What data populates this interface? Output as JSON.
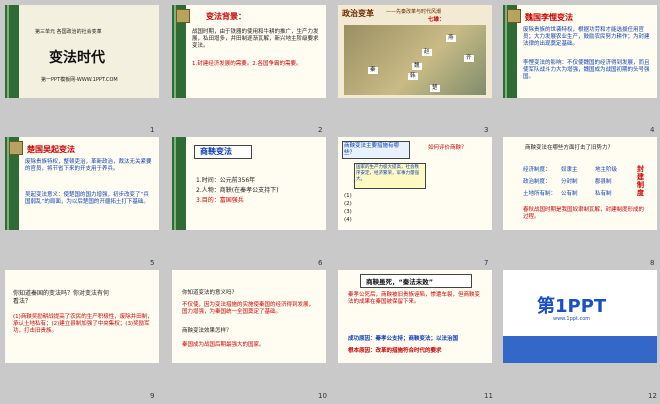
{
  "slides": [
    {
      "num": "1",
      "unit": "第三单元 各国政治的社会变革",
      "title": "变法时代",
      "footer": "第一PPT模板网-WWW.1PPT.COM"
    },
    {
      "num": "2",
      "heading": "变法背景：",
      "body": "战国时期，由于铁器的使用和牛耕的推广，生产力发展，私田增多，井田制逐渐瓦解，新兴地主阶级要求变法。",
      "point": "1.封建经济发展的需要。2.各国争霸的需要。"
    },
    {
      "num": "3",
      "title": "政治变革",
      "sub": "——先秦改革与时代风潮",
      "map_title": "七雄：",
      "states": [
        "燕",
        "齐",
        "赵",
        "魏",
        "韩",
        "秦",
        "楚"
      ]
    },
    {
      "num": "4",
      "heading": "魏国李悝变法",
      "body": "废除贵族的世袭特权，根据功劳和才能选拔任用官员；大力发展农业生产，鼓励农民努力耕作；为封建法律的出现奠定基础。",
      "point": "李悝变法的影响：不仅使魏国的经济得到发展，而且使军队战斗力大为增强，魏国成为战国初期的头号强国。"
    },
    {
      "num": "5",
      "heading": "楚国吴起变法",
      "body": "废除贵族特权，整顿吏治，革新政治，裁汰无关紧要的官员，将节省下来的开支用于养兵。",
      "point": "吴起变法意义：使楚国的国力增强，初步改变了“兵国弱乱”的局面，为以后楚国的开疆拓土打下基础。"
    },
    {
      "num": "6",
      "heading": "商鞅变法",
      "items": [
        "1.时间：公元前356年",
        "2.人物：商鞅(在秦孝公支持下)",
        "3.目的：富国强兵"
      ]
    },
    {
      "num": "7",
      "q1": "商鞅变法主要措施有哪些？",
      "q2": "如何评价商鞅？",
      "box": "国家的生产力极大提高，社会秩序安定，经济繁荣，军事力量强大。",
      "lines": [
        "(1)",
        "(2)",
        "(3)",
        "(4)"
      ]
    },
    {
      "num": "8",
      "lead": "商鞅变法在哪些方面打击了旧势力？",
      "rows": [
        [
          "经济制度：",
          "奴隶主",
          "地主阶级"
        ],
        [
          "政治制度：",
          "分封制",
          "郡县制"
        ],
        [
          "土地所有制：",
          "公有制",
          "私有制"
        ]
      ],
      "side": "封建制度",
      "result": "春秋战国时期是我国奴隶制瓦解，封建制度形成的过程。"
    },
    {
      "num": "9",
      "q": "你知道秦国的变法吗？你对变法有何看法？",
      "ans": "(1)商鞅奖励耕战提高了农民的生产积极性，废除井田制，承认土地私有；(2)建立县制加强了中央集权；(3)奖励军功，打击旧贵族。"
    },
    {
      "num": "10",
      "q": "你知道变法的意义吗？",
      "body": "不仅使，因为变法措施的实施使秦国的经济得到发展，国力增强，为秦国统一全国奠定了基础。",
      "q2": "商鞅变法效果怎样？",
      "note": "秦国成为战国后期最强大的国家。"
    },
    {
      "num": "11",
      "heading": "商鞅虽死，“秦法未败”",
      "body": "秦孝公死后，商鞅被旧贵族诬陷，惨遭车裂，但商鞅变法的成果在秦国被保留下来。",
      "success": "成功原因：秦孝公支持；商鞅变法；以法治国",
      "root": "根本原因：改革的措施符合时代的要求"
    },
    {
      "num": "12",
      "logo": "第1PPT",
      "site": "www.1ppt.com"
    }
  ],
  "colors": {
    "accent": "#c00000",
    "green": "#2f6b34",
    "blue": "#0a3db5"
  }
}
